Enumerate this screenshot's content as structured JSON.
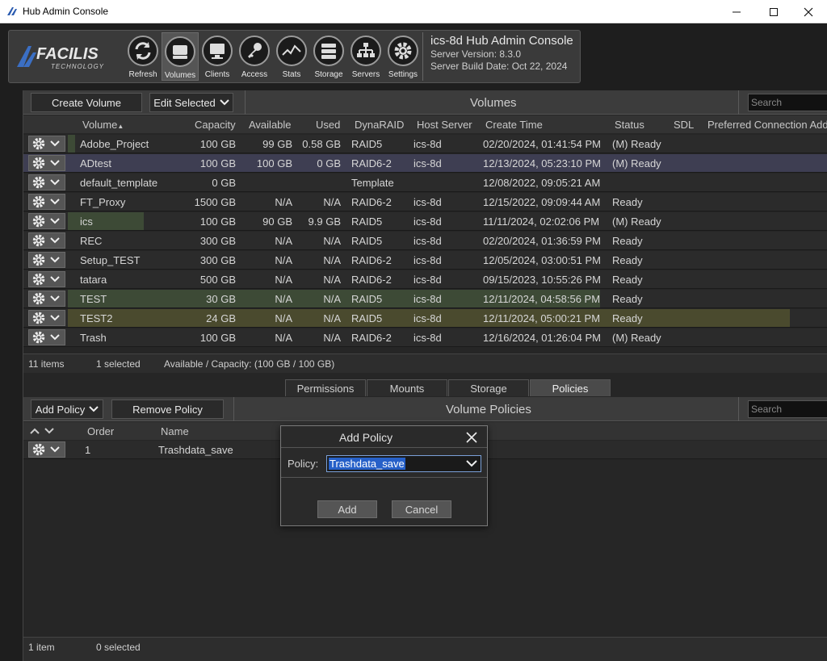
{
  "window": {
    "title": "Hub Admin Console",
    "controls": [
      "minimize",
      "maximize",
      "close"
    ]
  },
  "toolbar": {
    "logo_brand": "FACILIS",
    "logo_sub": "TECHNOLOGY",
    "buttons": [
      {
        "label": "Refresh",
        "icon": "refresh-icon"
      },
      {
        "label": "Volumes",
        "icon": "volumes-icon",
        "active": true
      },
      {
        "label": "Clients",
        "icon": "clients-icon"
      },
      {
        "label": "Access",
        "icon": "key-icon"
      },
      {
        "label": "Stats",
        "icon": "stats-icon"
      },
      {
        "label": "Storage",
        "icon": "storage-icon"
      },
      {
        "label": "Servers",
        "icon": "servers-icon"
      },
      {
        "label": "Settings",
        "icon": "gear-icon"
      }
    ]
  },
  "server": {
    "title": "ics-8d Hub Admin Console",
    "version": "Server Version: 8.3.0",
    "build_date": "Server Build Date: Oct 22, 2024"
  },
  "volumes": {
    "create_label": "Create Volume",
    "edit_label": "Edit Selected",
    "panel_title": "Volumes",
    "search_placeholder": "Search",
    "columns": [
      "Volume",
      "Capacity",
      "Available",
      "Used",
      "DynaRAID",
      "Host Server",
      "Create Time",
      "Status",
      "SDL",
      "Preferred Connection Add"
    ],
    "sort_indicator": "▲",
    "rows": [
      {
        "volume": "Adobe_Project",
        "capacity": "100 GB",
        "available": "99 GB",
        "used": "0.58 GB",
        "dynaraid": "RAID5",
        "host": "ics-8d",
        "created": "02/20/2024, 01:41:54 PM",
        "status": "(M) Ready",
        "used_fraction": 0.01
      },
      {
        "volume": "ADtest",
        "capacity": "100 GB",
        "available": "100 GB",
        "used": "0 GB",
        "dynaraid": "RAID6-2",
        "host": "ics-8d",
        "created": "12/13/2024, 05:23:10 PM",
        "status": "(M) Ready",
        "selected": true,
        "used_fraction": 0
      },
      {
        "volume": "default_template",
        "capacity": "0 GB",
        "available": "",
        "used": "",
        "dynaraid": "Template",
        "host": "",
        "created": "12/08/2022, 09:05:21 AM",
        "status": "",
        "used_fraction": 0
      },
      {
        "volume": "FT_Proxy",
        "capacity": "1500 GB",
        "available": "N/A",
        "used": "N/A",
        "dynaraid": "RAID6-2",
        "host": "ics-8d",
        "created": "12/15/2022, 09:09:44 AM",
        "status": "Ready",
        "used_fraction": 0
      },
      {
        "volume": "ics",
        "capacity": "100 GB",
        "available": "90 GB",
        "used": "9.9 GB",
        "dynaraid": "RAID5",
        "host": "ics-8d",
        "created": "11/11/2024, 02:02:06 PM",
        "status": "(M) Ready",
        "used_fraction": 0.1
      },
      {
        "volume": "REC",
        "capacity": "300 GB",
        "available": "N/A",
        "used": "N/A",
        "dynaraid": "RAID5",
        "host": "ics-8d",
        "created": "02/20/2024, 01:36:59 PM",
        "status": "Ready",
        "used_fraction": 0
      },
      {
        "volume": "Setup_TEST",
        "capacity": "300 GB",
        "available": "N/A",
        "used": "N/A",
        "dynaraid": "RAID6-2",
        "host": "ics-8d",
        "created": "12/05/2024, 03:00:51 PM",
        "status": "Ready",
        "used_fraction": 0
      },
      {
        "volume": "tatara",
        "capacity": "500 GB",
        "available": "N/A",
        "used": "N/A",
        "dynaraid": "RAID6-2",
        "host": "ics-8d",
        "created": "09/15/2023, 10:55:26 PM",
        "status": "Ready",
        "used_fraction": 0
      },
      {
        "volume": "TEST",
        "capacity": "30 GB",
        "available": "N/A",
        "used": "N/A",
        "dynaraid": "RAID5",
        "host": "ics-8d",
        "created": "12/11/2024, 04:58:56 PM",
        "status": "Ready",
        "used_fraction": 0.7
      },
      {
        "volume": "TEST2",
        "capacity": "24 GB",
        "available": "N/A",
        "used": "N/A",
        "dynaraid": "RAID5",
        "host": "ics-8d",
        "created": "12/11/2024, 05:00:21 PM",
        "status": "Ready",
        "used_fraction": 0.95
      },
      {
        "volume": "Trash",
        "capacity": "100 GB",
        "available": "N/A",
        "used": "N/A",
        "dynaraid": "RAID6-2",
        "host": "ics-8d",
        "created": "12/16/2024, 01:26:04 PM",
        "status": "(M) Ready",
        "used_fraction": 0
      }
    ],
    "status_count": "11 items",
    "status_selected": "1 selected",
    "status_capacity": "Available / Capacity: (100 GB / 100 GB)"
  },
  "tabs": [
    {
      "label": "Permissions"
    },
    {
      "label": "Mounts"
    },
    {
      "label": "Storage"
    },
    {
      "label": "Policies",
      "active": true
    }
  ],
  "policies": {
    "add_label": "Add Policy",
    "remove_label": "Remove Policy",
    "panel_title": "Volume Policies",
    "search_placeholder": "Search",
    "columns": [
      "Order",
      "Name"
    ],
    "rows": [
      {
        "order": "1",
        "name": "Trashdata_save"
      }
    ],
    "status_count": "1 item",
    "status_selected": "0 selected"
  },
  "dialog": {
    "title": "Add Policy",
    "policy_label": "Policy:",
    "policy_value": "Trashdata_save",
    "add_label": "Add",
    "cancel_label": "Cancel"
  },
  "colors": {
    "accent": "#2660c8",
    "usage_green": "#3d4a36",
    "usage_yellow": "#4a4a2e",
    "selected_row": "#3e3e52"
  }
}
